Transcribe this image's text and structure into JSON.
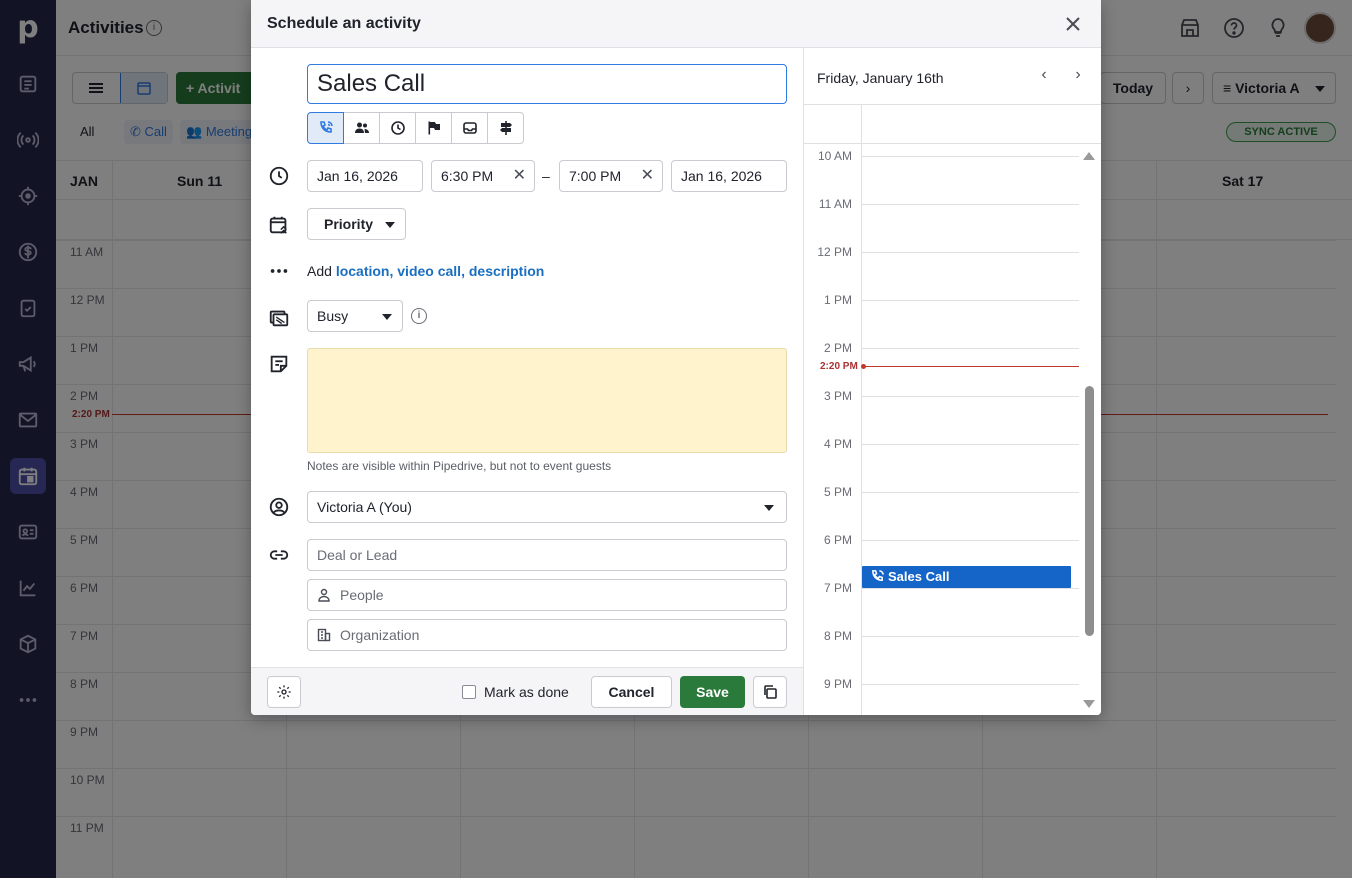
{
  "app": {
    "logo": "p",
    "page_title": "Activities",
    "nav_icons": [
      "leads-icon",
      "campaign-broadcast-icon",
      "target-icon",
      "dollar-icon",
      "clipboard-icon",
      "megaphone-icon",
      "mail-icon",
      "calendar-icon",
      "contact-card-icon",
      "chart-icon",
      "box-icon",
      "more-icon"
    ],
    "active_nav": "calendar-icon"
  },
  "background": {
    "add_button_label": "+ Activit",
    "filter_all": "All",
    "filter_call": "Call",
    "filter_meeting": "Meeting",
    "today_label": "Today",
    "next_label": "›",
    "user_filter": "Victoria A",
    "sync_label": "SYNC ACTIVE",
    "month": "JAN",
    "days": [
      "Sun 11",
      "Sat 17"
    ],
    "hours": [
      "11 AM",
      "12 PM",
      "1 PM",
      "2 PM",
      "3 PM",
      "4 PM",
      "5 PM",
      "6 PM",
      "7 PM",
      "8 PM",
      "9 PM",
      "10 PM",
      "11 PM"
    ],
    "now_label": "2:20 PM"
  },
  "modal": {
    "title": "Schedule an activity",
    "subject": "Sales Call",
    "activity_types": [
      "call-icon",
      "meeting-icon",
      "task-icon",
      "deadline-flag-icon",
      "email-inbox-icon",
      "lunch-icon"
    ],
    "start_date": "Jan 16, 2026",
    "start_time": "6:30 PM",
    "dash": "–",
    "end_time": "7:00 PM",
    "end_date": "Jan 16, 2026",
    "clear_symbol": "✕",
    "priority_label": "Priority",
    "add_prefix": "Add",
    "add_location": "location,",
    "add_video": "video call,",
    "add_description": "description",
    "availability": "Busy",
    "notes_hint": "Notes are visible within Pipedrive, but not to event guests",
    "owner": "Victoria A (You)",
    "deal_placeholder": "Deal or Lead",
    "people_placeholder": "People",
    "organization_placeholder": "Organization",
    "mark_done_label": "Mark as done",
    "cancel_label": "Cancel",
    "save_label": "Save"
  },
  "mini_calendar": {
    "date_label": "Friday, January 16th",
    "prev": "‹",
    "next": "›",
    "hours": [
      "10 AM",
      "11 AM",
      "12 PM",
      "1 PM",
      "2 PM",
      "3 PM",
      "4 PM",
      "5 PM",
      "6 PM",
      "7 PM",
      "8 PM",
      "9 PM"
    ],
    "now_label": "2:20 PM",
    "event_title": "Sales Call"
  },
  "colors": {
    "nav_bg": "#26264d",
    "primary_green": "#2a7a3b",
    "link_blue": "#1b6fc0",
    "event_blue": "#1565c8",
    "now_red": "#c0392b",
    "notes_bg": "#fff3cd"
  }
}
